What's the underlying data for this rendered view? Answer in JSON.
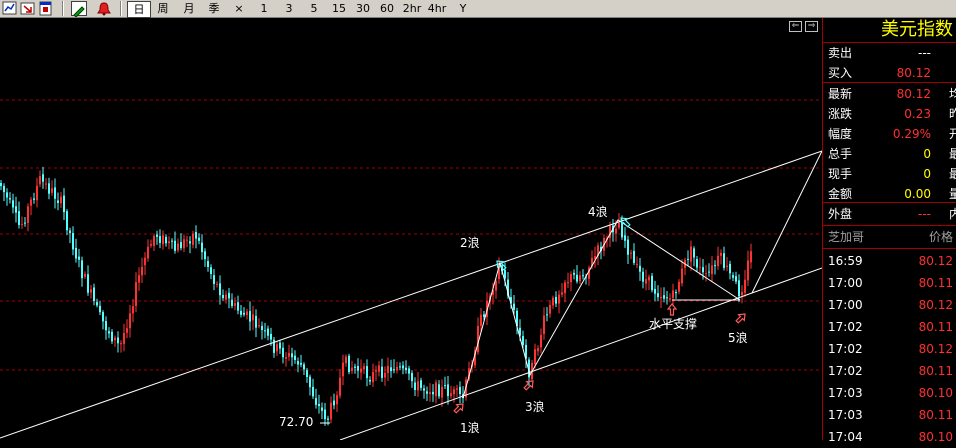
{
  "toolbar": {
    "icons": [
      "chart-icon",
      "export-icon",
      "window-icon",
      "draw-icon",
      "alarm-icon"
    ],
    "periods": [
      {
        "label": "日",
        "active": true
      },
      {
        "label": "周",
        "active": false
      },
      {
        "label": "月",
        "active": false
      },
      {
        "label": "季",
        "active": false
      },
      {
        "label": "×",
        "active": false
      },
      {
        "label": "1",
        "active": false
      },
      {
        "label": "3",
        "active": false
      },
      {
        "label": "5",
        "active": false
      },
      {
        "label": "15",
        "active": false
      },
      {
        "label": "30",
        "active": false
      },
      {
        "label": "60",
        "active": false
      },
      {
        "label": "2hr",
        "active": false
      },
      {
        "label": "4hr",
        "active": false
      },
      {
        "label": "Y",
        "active": false
      }
    ]
  },
  "chart": {
    "low_label": "72.70",
    "waves": [
      "1浪",
      "2浪",
      "3浪",
      "4浪",
      "5浪"
    ],
    "support_label": "水平支撑",
    "colors": {
      "up": "#ff3232",
      "down": "#54ffff",
      "grid": "#a00000",
      "annotation": "#ffffff",
      "arrow": "#ff5a5a",
      "arrow_teal": "#54ffff"
    }
  },
  "panel": {
    "title": "美元指数",
    "quotes": [
      {
        "label": "卖出",
        "value": "---",
        "cut": "",
        "color": "#ffffff"
      },
      {
        "label": "买入",
        "value": "80.12",
        "cut": "",
        "color": "#ff3030"
      },
      {
        "label": "最新",
        "value": "80.12",
        "cut": "均",
        "color": "#ff3030"
      },
      {
        "label": "涨跌",
        "value": "0.23",
        "cut": "昨",
        "color": "#ff3030"
      },
      {
        "label": "幅度",
        "value": "0.29%",
        "cut": "开",
        "color": "#ff3030"
      },
      {
        "label": "总手",
        "value": "0",
        "cut": "最",
        "color": "#ffff00"
      },
      {
        "label": "现手",
        "value": "0",
        "cut": "最",
        "color": "#ffff00"
      },
      {
        "label": "金额",
        "value": "0.00",
        "cut": "量",
        "color": "#ffff00"
      },
      {
        "label": "外盘",
        "value": "---",
        "cut": "内",
        "color": "#ff3030"
      }
    ],
    "ticks_header": {
      "left": "芝加哥",
      "right": "价格"
    },
    "ticks": [
      {
        "time": "16:59",
        "price": "80.12"
      },
      {
        "time": "17:00",
        "price": "80.11"
      },
      {
        "time": "17:00",
        "price": "80.12"
      },
      {
        "time": "17:02",
        "price": "80.11"
      },
      {
        "time": "17:02",
        "price": "80.12"
      },
      {
        "time": "17:02",
        "price": "80.11"
      },
      {
        "time": "17:03",
        "price": "80.10"
      },
      {
        "time": "17:03",
        "price": "80.11"
      },
      {
        "time": "17:04",
        "price": "80.10"
      }
    ]
  }
}
